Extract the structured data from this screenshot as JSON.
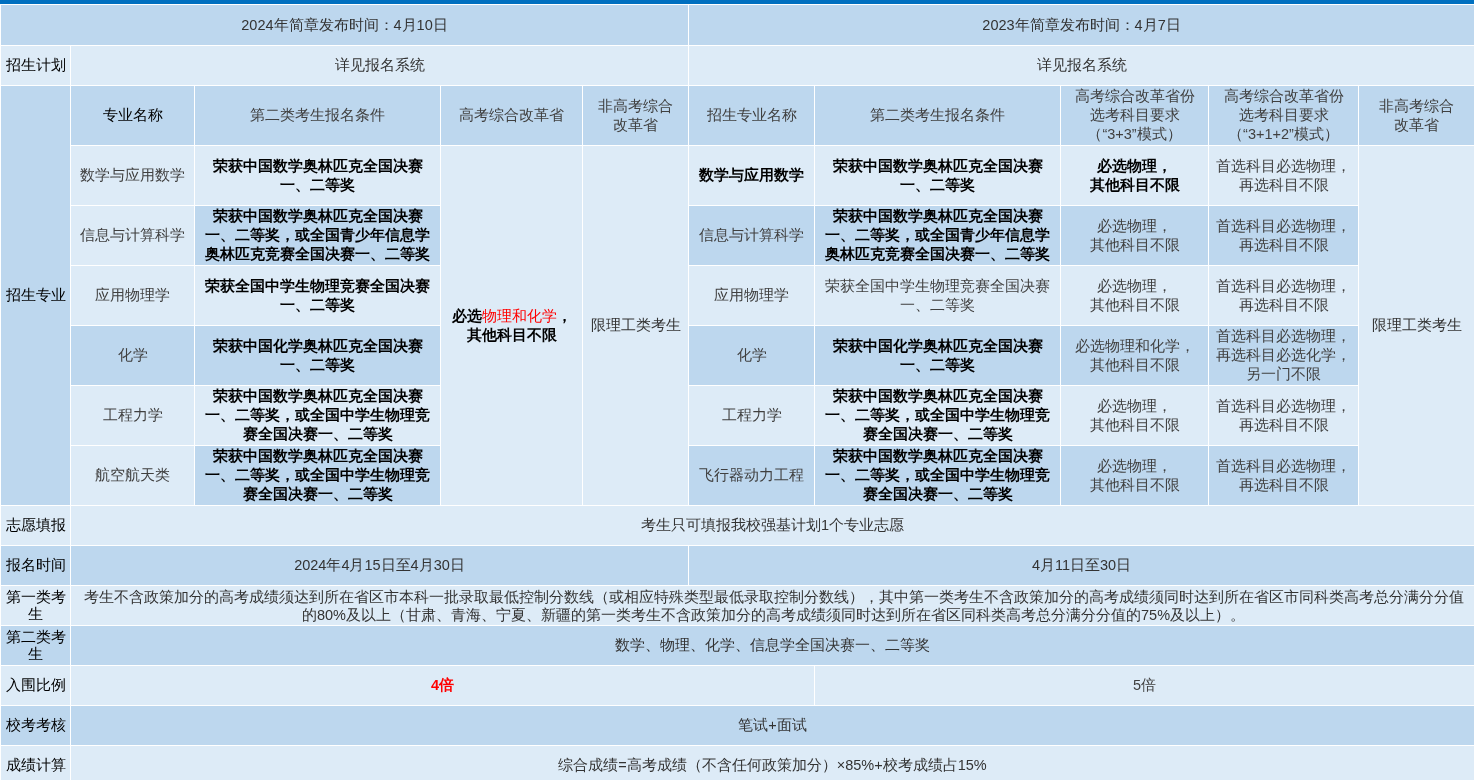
{
  "release": [
    "2024年简章发布时间：4月10日",
    "2023年简章发布时间：4月7日"
  ],
  "plan": {
    "label": "招生计划",
    "values": [
      "详见报名系统",
      "详见报名系统"
    ]
  },
  "majors": {
    "label": "招生专业",
    "y2024": {
      "columns": [
        [
          "专业名称"
        ],
        [
          "第二类考生报名条件"
        ],
        [
          "高考综合改革省"
        ],
        [
          "非高考综合",
          "改革省"
        ]
      ],
      "rows": [
        {
          "name": {
            "lines": [
              "数学与应用数学"
            ],
            "bold": false,
            "red": false
          },
          "condition": {
            "lines": [
              "荣获中国数学奥林匹克全国决赛一、二等奖"
            ],
            "bold": true,
            "red": false
          }
        },
        {
          "name": {
            "lines": [
              "信息与计算科学"
            ],
            "bold": false,
            "red": false
          },
          "condition": {
            "lines": [
              "荣获中国数学奥林匹克全国决赛一、二等奖，或全国青少年信息学奥林匹克竞赛全国决赛一、二等奖"
            ],
            "bold": true,
            "red": false
          }
        },
        {
          "name": {
            "lines": [
              "应用物理学"
            ],
            "bold": false,
            "red": false
          },
          "condition": {
            "lines": [
              "荣获全国中学生物理竞赛全国决赛一、二等奖"
            ],
            "bold": true,
            "red": false
          }
        },
        {
          "name": {
            "lines": [
              "化学"
            ],
            "bold": false,
            "red": false
          },
          "condition": {
            "lines": [
              "荣获中国化学奥林匹克全国决赛一、二等奖"
            ],
            "bold": true,
            "red": false
          }
        },
        {
          "name": {
            "lines": [
              "工程力学"
            ],
            "bold": false,
            "red": false
          },
          "condition": {
            "lines": [
              "荣获中国数学奥林匹克全国决赛一、二等奖，或全国中学生物理竞赛全国决赛一、二等奖"
            ],
            "bold": true,
            "red": false
          }
        },
        {
          "name": {
            "lines": [
              "航空航天类"
            ],
            "bold": false,
            "red": false
          },
          "condition": {
            "lines": [
              "荣获中国数学奥林匹克全国决赛一、二等奖，或全国中学生物理竞赛全国决赛一、二等奖"
            ],
            "bold": true,
            "red": false
          }
        }
      ],
      "reform": {
        "prefix": "必选",
        "highlight": "物理和化学",
        "suffix": "，",
        "second_line": "其他科目不限"
      },
      "non_reform": "限理工类考生"
    },
    "y2023": {
      "columns": [
        [
          "招生专业名称"
        ],
        [
          "第二类考生报名条件"
        ],
        [
          "高考综合改革省份",
          "选考科目要求",
          "（“3+3”模式）"
        ],
        [
          "高考综合改革省份",
          "选考科目要求",
          "（“3+1+2”模式）"
        ],
        [
          "非高考综合",
          "改革省"
        ]
      ],
      "rows": [
        {
          "name": {
            "lines": [
              "数学与应用数学"
            ],
            "bold": true,
            "red": false
          },
          "condition": {
            "lines": [
              "荣获中国数学奥林匹克全国决赛一、二等奖"
            ],
            "bold": true,
            "red": false
          },
          "mode_33": {
            "lines": [
              "必选物理，",
              "其他科目不限"
            ],
            "bold": true,
            "red": false
          },
          "mode_312": {
            "lines": [
              "首选科目必选物理，",
              "再选科目不限"
            ],
            "bold": false,
            "red": false
          }
        },
        {
          "name": {
            "lines": [
              "信息与计算科学"
            ],
            "bold": false,
            "red": false
          },
          "condition": {
            "lines": [
              "荣获中国数学奥林匹克全国决赛一、二等奖，或全国青少年信息学奥林匹克竞赛全国决赛一、二等奖"
            ],
            "bold": true,
            "red": false
          },
          "mode_33": {
            "lines": [
              "必选物理，",
              "其他科目不限"
            ],
            "bold": false,
            "red": false
          },
          "mode_312": {
            "lines": [
              "首选科目必选物理，",
              "再选科目不限"
            ],
            "bold": false,
            "red": false
          }
        },
        {
          "name": {
            "lines": [
              "应用物理学"
            ],
            "bold": false,
            "red": false
          },
          "condition": {
            "lines": [
              "荣获全国中学生物理竞赛全国决赛一、二等奖"
            ],
            "bold": false,
            "red": false
          },
          "mode_33": {
            "lines": [
              "必选物理，",
              "其他科目不限"
            ],
            "bold": false,
            "red": false
          },
          "mode_312": {
            "lines": [
              "首选科目必选物理，",
              "再选科目不限"
            ],
            "bold": false,
            "red": false
          }
        },
        {
          "name": {
            "lines": [
              "化学"
            ],
            "bold": false,
            "red": false
          },
          "condition": {
            "lines": [
              "荣获中国化学奥林匹克全国决赛一、二等奖"
            ],
            "bold": true,
            "red": false
          },
          "mode_33": {
            "lines": [
              "必选物理和化学，",
              "其他科目不限"
            ],
            "bold": false,
            "red": false
          },
          "mode_312": {
            "lines": [
              "首选科目必选物理，",
              "再选科目必选化学，",
              "另一门不限"
            ],
            "bold": false,
            "red": false
          }
        },
        {
          "name": {
            "lines": [
              "工程力学"
            ],
            "bold": false,
            "red": false
          },
          "condition": {
            "lines": [
              "荣获中国数学奥林匹克全国决赛一、二等奖，或全国中学生物理竞赛全国决赛一、二等奖"
            ],
            "bold": true,
            "red": false
          },
          "mode_33": {
            "lines": [
              "必选物理，",
              "其他科目不限"
            ],
            "bold": false,
            "red": false
          },
          "mode_312": {
            "lines": [
              "首选科目必选物理，",
              "再选科目不限"
            ],
            "bold": false,
            "red": false
          }
        },
        {
          "name": {
            "lines": [
              "飞行器动力工程"
            ],
            "bold": false,
            "red": false
          },
          "condition": {
            "lines": [
              "荣获中国数学奥林匹克全国决赛一、二等奖，或全国中学生物理竞赛全国决赛一、二等奖"
            ],
            "bold": true,
            "red": false
          },
          "mode_33": {
            "lines": [
              "必选物理，",
              "其他科目不限"
            ],
            "bold": false,
            "red": false
          },
          "mode_312": {
            "lines": [
              "首选科目必选物理，",
              "再选科目不限"
            ],
            "bold": false,
            "red": false
          }
        }
      ],
      "non_reform": "限理工类考生"
    }
  },
  "wish": {
    "label": "志愿填报",
    "value": "考生只可填报我校强基计划1个专业志愿"
  },
  "period": {
    "label": "报名时间",
    "values": [
      "2024年4月15日至4月30日",
      "4月11日至30日"
    ]
  },
  "first_class": {
    "label": "第一类考生",
    "value": "考生不含政策加分的高考成绩须达到所在省区市本科一批录取最低控制分数线（或相应特殊类型最低录取控制分数线），其中第一类考生不含政策加分的高考成绩须同时达到所在省区市同科类高考总分满分分值的80%及以上（甘肃、青海、宁夏、新疆的第一类考生不含政策加分的高考成绩须同时达到所在省区同科类高考总分满分分值的75%及以上）。"
  },
  "second_class": {
    "label": "第二类考生",
    "value": "数学、物理、化学、信息学全国决赛一、二等奖"
  },
  "ratio": {
    "label": "入围比例",
    "values": [
      {
        "lines": [
          "4倍"
        ],
        "bold": true,
        "red": true
      },
      {
        "lines": [
          "5倍"
        ],
        "bold": false,
        "red": false
      }
    ]
  },
  "exam": {
    "label": "校考考核",
    "value": "笔试+面试"
  },
  "score": {
    "label": "成绩计算",
    "value": "综合成绩=高考成绩（不含任何政策加分）×85%+校考成绩占15%"
  }
}
